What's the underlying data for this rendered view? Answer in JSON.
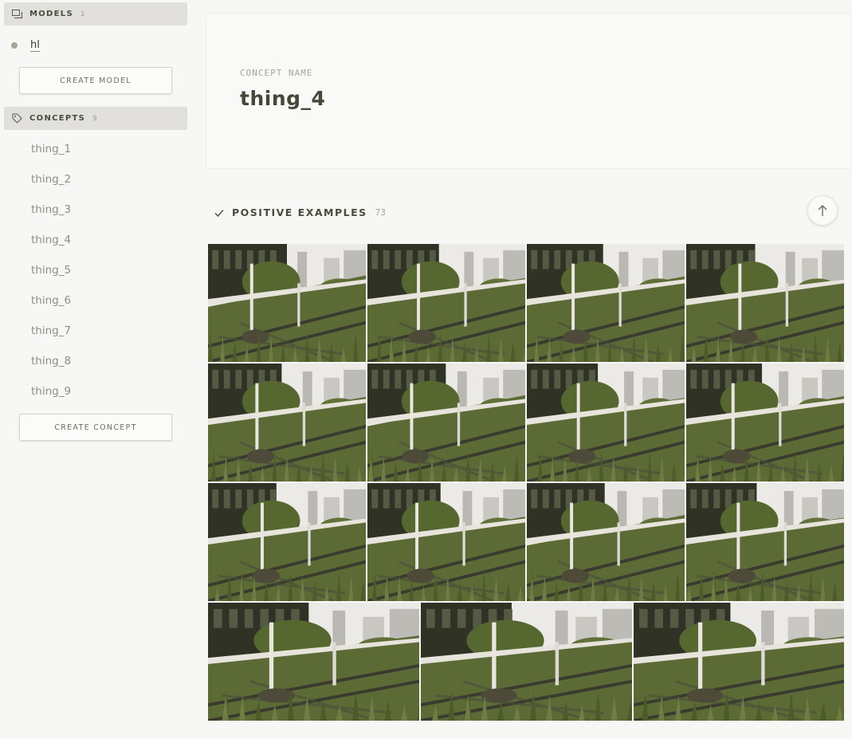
{
  "sidebar": {
    "models_header": {
      "label": "MODELS",
      "count": "1"
    },
    "models": [
      {
        "name": "hl"
      }
    ],
    "create_model_label": "CREATE MODEL",
    "concepts_header": {
      "label": "CONCEPTS",
      "count": "9"
    },
    "concepts": [
      "thing_1",
      "thing_2",
      "thing_3",
      "thing_4",
      "thing_5",
      "thing_6",
      "thing_7",
      "thing_8",
      "thing_9"
    ],
    "create_concept_label": "CREATE CONCEPT"
  },
  "concept": {
    "label": "CONCEPT NAME",
    "name": "thing_4"
  },
  "positives": {
    "label": "POSITIVE EXAMPLES",
    "count": "73",
    "icon": "check-icon"
  },
  "colors": {
    "header_bg": "#e1e0dd",
    "text_dark": "#45473a",
    "text_muted": "#8f8e84",
    "grass": "#5f6d3b",
    "sky": "#eeeeec"
  }
}
